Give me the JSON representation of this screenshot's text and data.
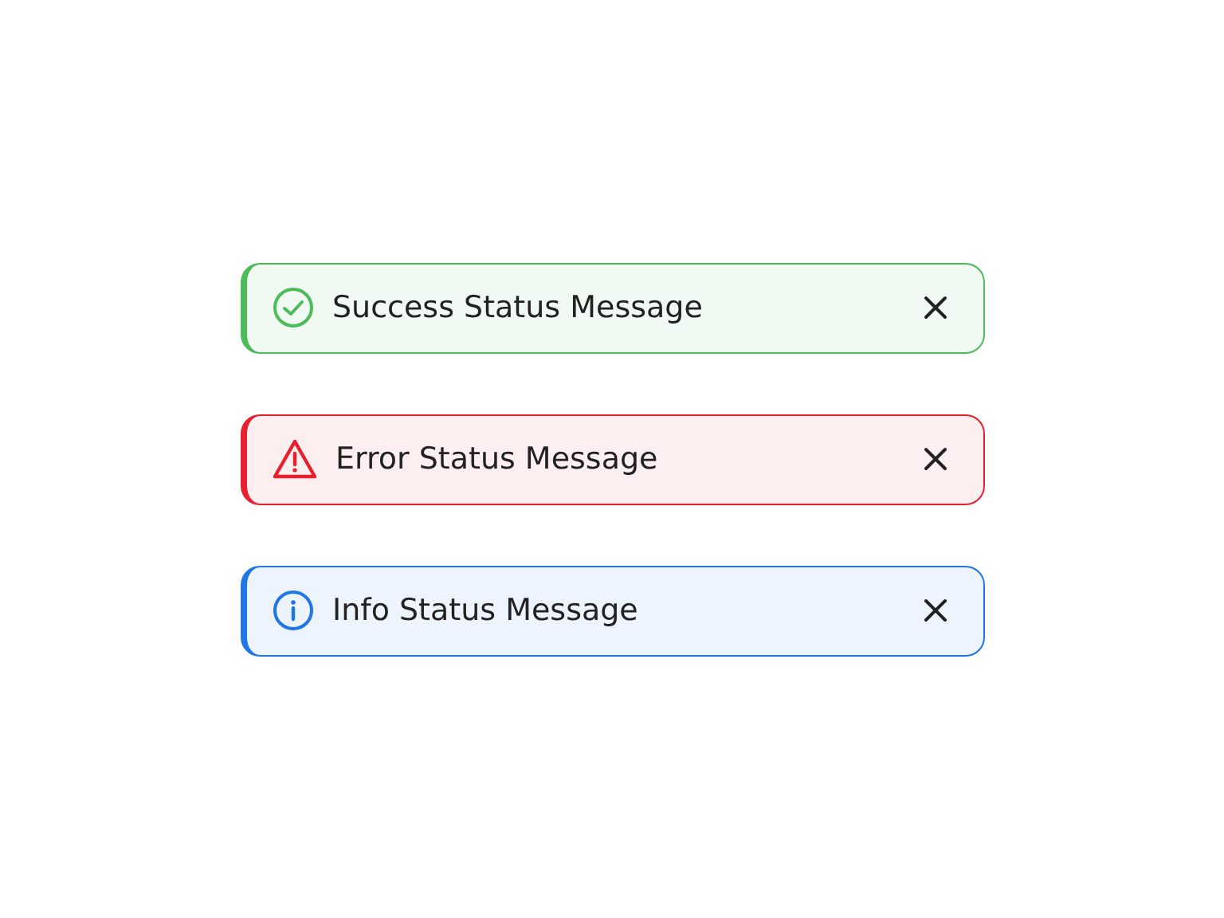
{
  "alerts": [
    {
      "kind": "success",
      "color": "#4cbb5a",
      "message": "Success Status Message"
    },
    {
      "kind": "error",
      "color": "#e8202e",
      "message": "Error Status Message"
    },
    {
      "kind": "info",
      "color": "#2176e6",
      "message": "Info Status Message"
    }
  ]
}
